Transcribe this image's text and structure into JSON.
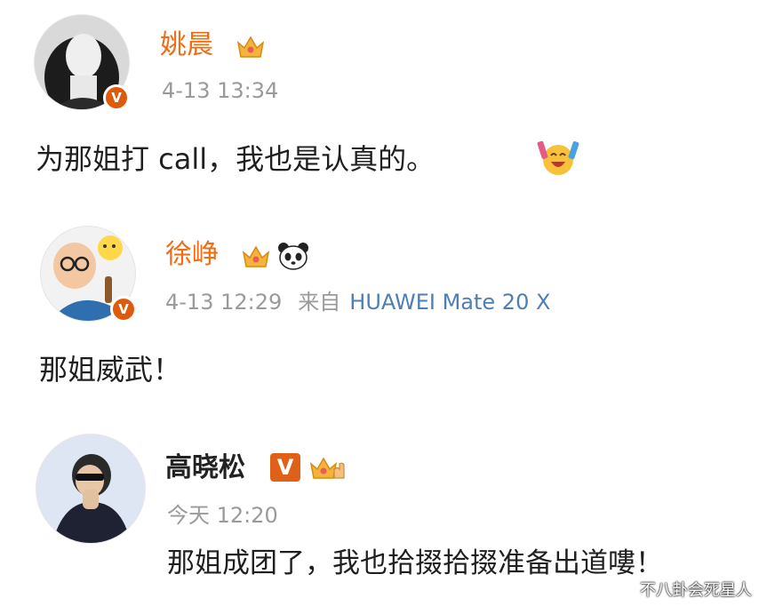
{
  "posts": [
    {
      "name": "姚晨",
      "time": "4-13 13:34",
      "content": "为那姐打 call，我也是认真的。",
      "verified": "V"
    },
    {
      "name": "徐峥",
      "time": "4-13 12:29",
      "from_label": "来自",
      "device": "HUAWEI Mate 20 X",
      "content": "那姐威武！",
      "verified": "V"
    },
    {
      "name": "高晓松",
      "time": "今天 12:20",
      "content": "那姐成团了，我也拾掇拾掇准备出道嘍！",
      "verified": "V"
    }
  ],
  "watermark": "不八卦会死星人",
  "colors": {
    "name_orange": "#f06b12",
    "meta_gray": "#9a9a9a",
    "device_blue": "#4d7fb5",
    "badge_red": "#e05a0c",
    "badge_orange": "#f5a623"
  },
  "icons": {
    "post1_name_badge": "crown-icon",
    "post1_content_emoji": "cheering-emoji-icon",
    "post2_name_badges": [
      "crown-icon",
      "panda-icon"
    ],
    "post3_name_badges": [
      "vip-v-icon",
      "crown-hand-icon"
    ]
  }
}
